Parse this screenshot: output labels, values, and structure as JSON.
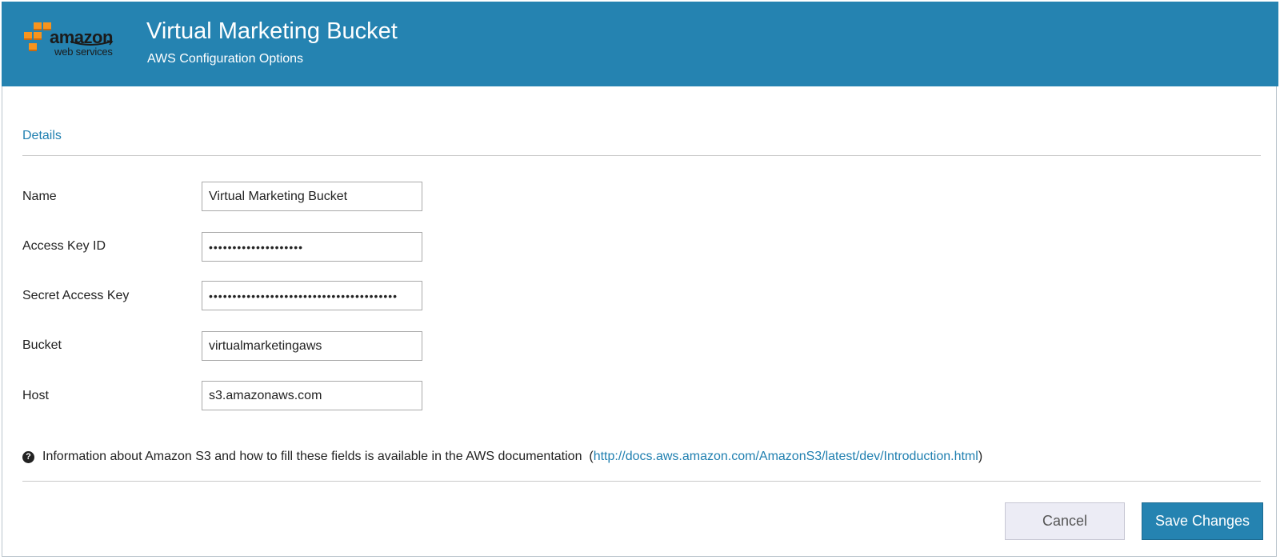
{
  "header": {
    "logo": {
      "wordmark": "amazon",
      "tagline": "web services",
      "brand_colors": [
        "#f7941d",
        "#1b1b1b"
      ]
    },
    "title": "Virtual Marketing Bucket",
    "subtitle": "AWS Configuration Options",
    "background_color": "#2583b1"
  },
  "section": {
    "label": "Details"
  },
  "form": {
    "fields": [
      {
        "label": "Name",
        "value": "Virtual Marketing Bucket",
        "type": "text"
      },
      {
        "label": "Access Key ID",
        "value": "••••••••••••••••••••",
        "type": "password"
      },
      {
        "label": "Secret Access Key",
        "value": "••••••••••••••••••••••••••••••••••••••••",
        "type": "password"
      },
      {
        "label": "Bucket",
        "value": "virtualmarketingaws",
        "type": "text"
      },
      {
        "label": "Host",
        "value": "s3.amazonaws.com",
        "type": "text"
      }
    ]
  },
  "info": {
    "icon": "question-circle-icon",
    "text": "Information about Amazon S3 and how to fill these fields is available in the AWS documentation",
    "link_open": "(",
    "link": "http://docs.aws.amazon.com/AmazonS3/latest/dev/Introduction.html",
    "link_close": ")"
  },
  "actions": {
    "cancel_label": "Cancel",
    "save_label": "Save Changes",
    "primary_color": "#2583b1"
  }
}
